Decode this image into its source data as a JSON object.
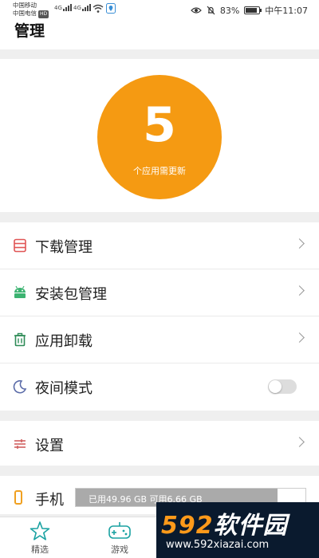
{
  "statusbar": {
    "carrier1": "中国移动",
    "carrier2": "中国电信",
    "hd": "HD",
    "net1": "4G",
    "net2": "4G",
    "battery_pct": "83%",
    "battery_level": 0.83,
    "time": "中午11:07"
  },
  "header": {
    "title": "管理"
  },
  "hero": {
    "count": "5",
    "subtitle": "个应用需更新"
  },
  "menu": {
    "download": "下载管理",
    "package": "安装包管理",
    "uninstall": "应用卸载",
    "night": "夜间模式",
    "night_on": false,
    "settings": "设置"
  },
  "storage": {
    "label": "手机",
    "text": "已用49.96 GB  可用6.66 GB",
    "used_fraction": 0.88
  },
  "tabs": [
    {
      "label": "精选",
      "icon": "star-icon"
    },
    {
      "label": "游戏",
      "icon": "gamepad-icon"
    }
  ],
  "watermark": {
    "brand_num": "592",
    "brand_cn": "软件园",
    "url": "www.592xiazai.com"
  },
  "colors": {
    "accent": "#f59a12",
    "download_icon": "#e05555",
    "package_icon": "#3cb371",
    "uninstall_icon": "#2e8b57",
    "night_icon": "#5a6ba8",
    "settings_icon": "#d06060",
    "phone_icon": "#f0a020"
  }
}
